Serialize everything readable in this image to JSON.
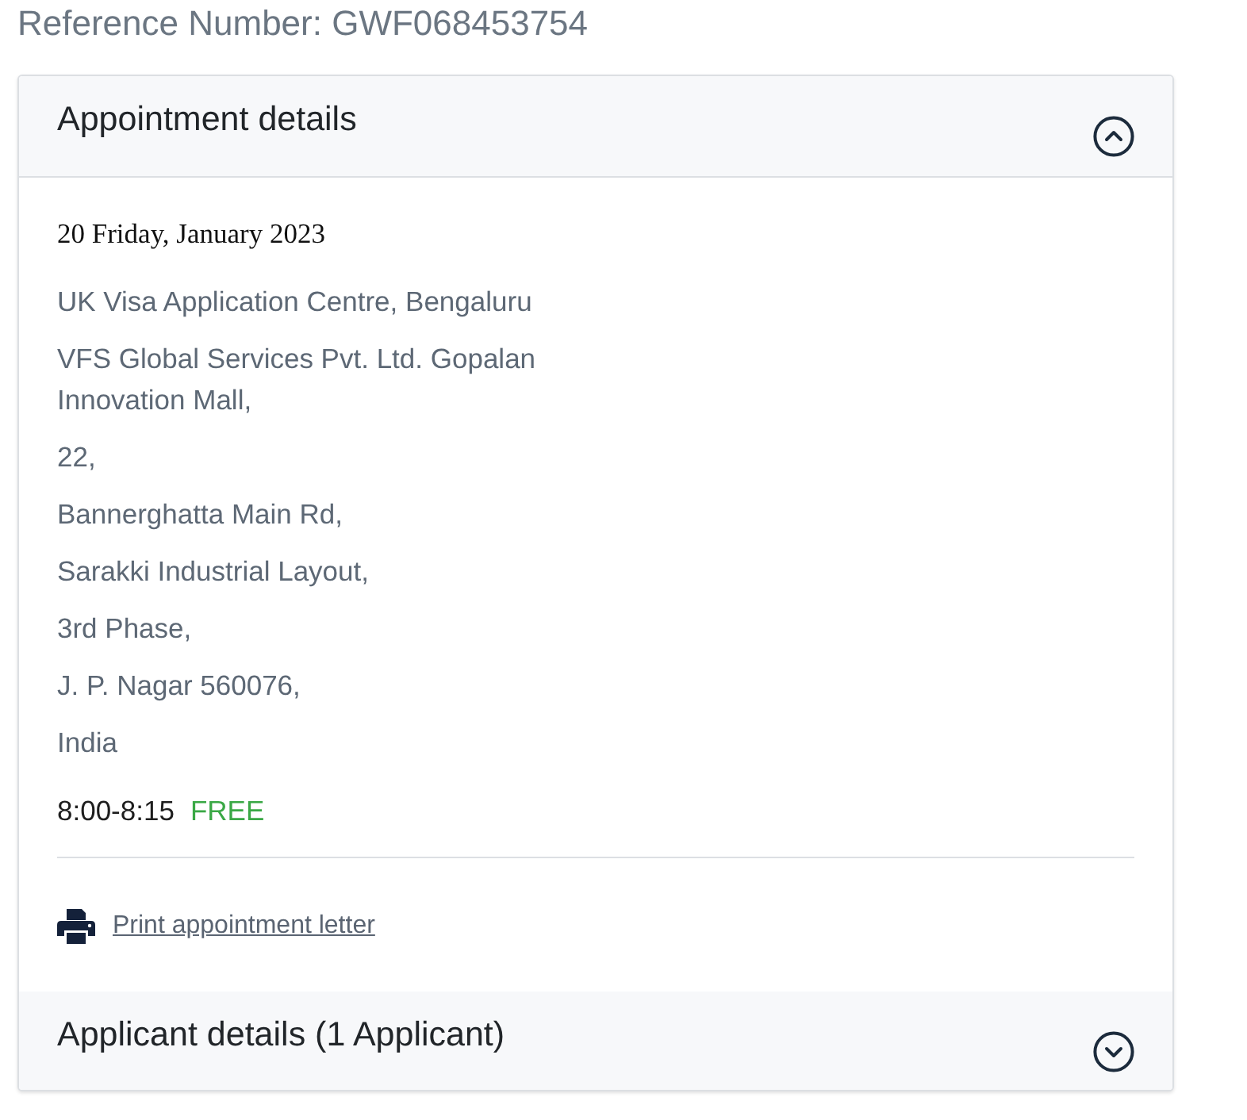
{
  "reference_number": "Reference Number: GWF068453754",
  "sections": [
    {
      "title": "Appointment details",
      "expanded": true,
      "date": "20 Friday, January 2023",
      "address_lines": [
        "UK Visa Application Centre, Bengaluru",
        "VFS Global Services Pvt. Ltd. Gopalan Innovation Mall,",
        "22,",
        "Bannerghatta Main Rd,",
        "Sarakki Industrial Layout,",
        "3rd Phase,",
        "J. P. Nagar 560076,",
        "India"
      ],
      "time": "8:00-8:15",
      "price": "FREE",
      "print_link": "Print appointment letter"
    },
    {
      "title": "Applicant details (1 Applicant)",
      "expanded": false
    }
  ]
}
